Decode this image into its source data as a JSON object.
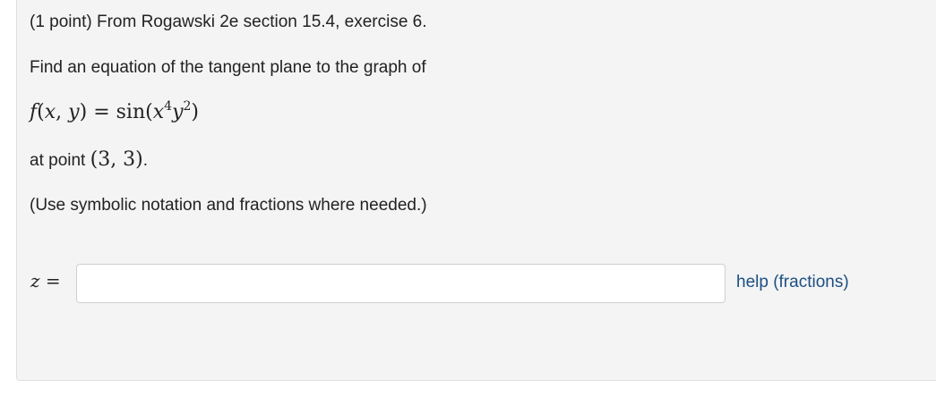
{
  "problem": {
    "header": "(1 point) From Rogawski 2e section 15.4, exercise 6.",
    "instruction": "Find an equation of the tangent plane to the graph of",
    "function": {
      "lhs_name": "f",
      "lhs_open": "(",
      "lhs_x": "x",
      "lhs_comma": ", ",
      "lhs_y": "y",
      "lhs_close": ")",
      "equals": " = ",
      "rhs_func": "sin",
      "rhs_open": "(",
      "rhs_x": "x",
      "rhs_x_exp": "4",
      "rhs_y": "y",
      "rhs_y_exp": "2",
      "rhs_close": ")"
    },
    "point_prefix": "at point ",
    "point_value": "(3,  3)",
    "point_suffix": ".",
    "note": "(Use symbolic notation and fractions where needed.)"
  },
  "answer": {
    "label_var": "z",
    "label_equals": " =",
    "value": "",
    "placeholder": ""
  },
  "help": {
    "label": "help (fractions)"
  }
}
